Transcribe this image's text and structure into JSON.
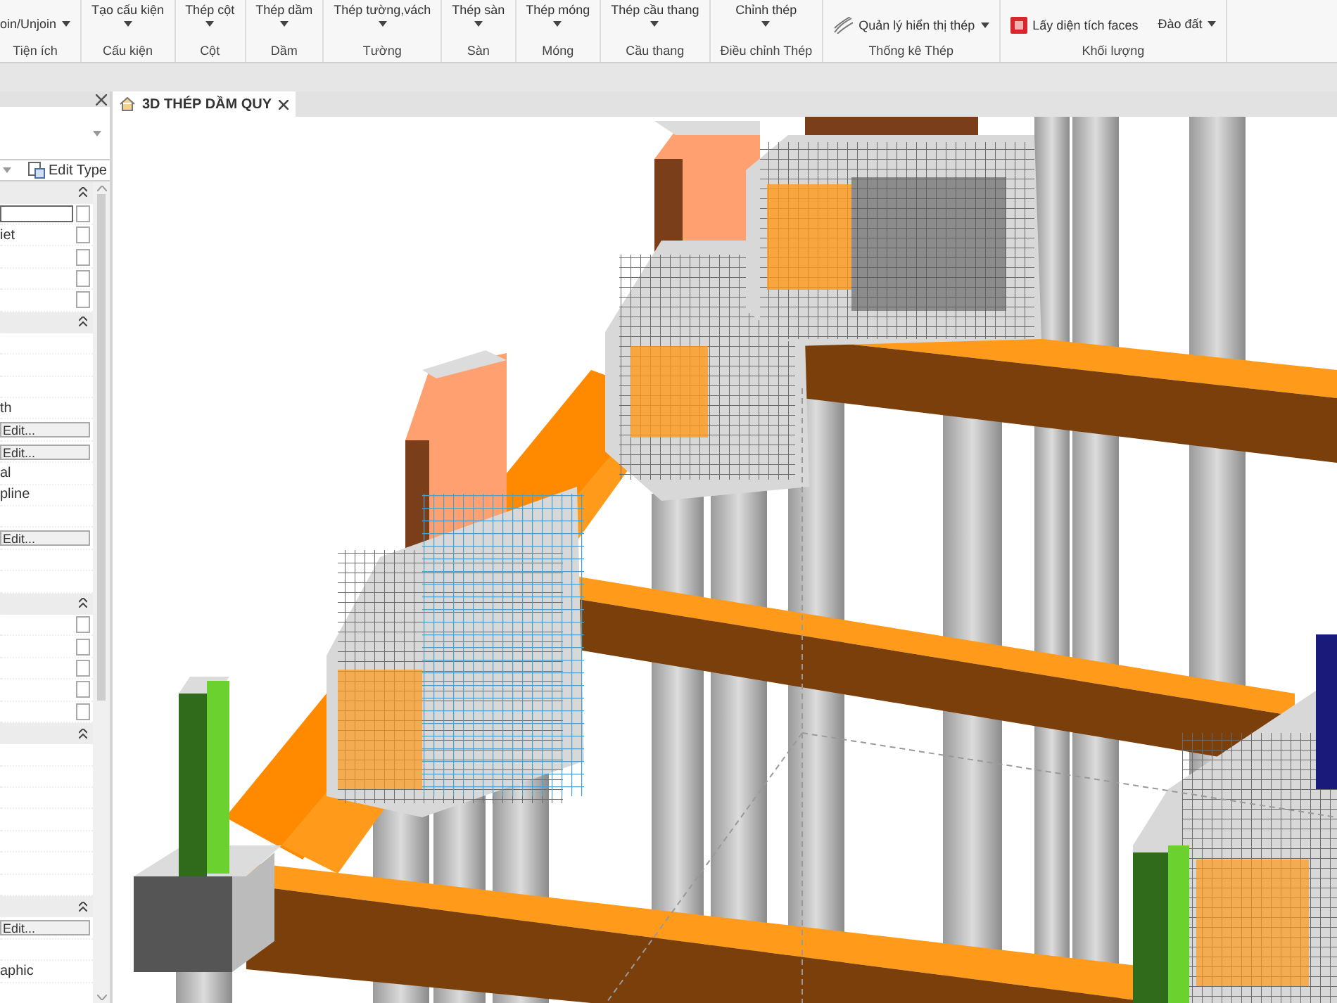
{
  "ribbon": {
    "groups": [
      {
        "label": "Tiện ích",
        "items": [
          {
            "kind": "small",
            "label": "oin/Unjoin",
            "dropdown": true
          }
        ]
      },
      {
        "label": "Cấu kiện",
        "items": [
          {
            "kind": "big",
            "label": "Tạo cấu kiện",
            "dropdown": true
          }
        ]
      },
      {
        "label": "Cột",
        "items": [
          {
            "kind": "big",
            "label": "Thép cột",
            "dropdown": true
          }
        ]
      },
      {
        "label": "Dầm",
        "items": [
          {
            "kind": "big",
            "label": "Thép dầm",
            "dropdown": true
          }
        ]
      },
      {
        "label": "Tường",
        "items": [
          {
            "kind": "big",
            "label": "Thép tường,vách",
            "dropdown": true
          }
        ]
      },
      {
        "label": "Sàn",
        "items": [
          {
            "kind": "big",
            "label": "Thép sàn",
            "dropdown": true
          }
        ]
      },
      {
        "label": "Móng",
        "items": [
          {
            "kind": "big",
            "label": "Thép móng",
            "dropdown": true
          }
        ]
      },
      {
        "label": "Cầu thang",
        "items": [
          {
            "kind": "big",
            "label": "Thép cầu thang",
            "dropdown": true
          }
        ]
      },
      {
        "label": "Điều chỉnh Thép",
        "items": [
          {
            "kind": "big",
            "label": "Chỉnh thép",
            "dropdown": true
          }
        ]
      },
      {
        "label": "Thống kê Thép",
        "items": [
          {
            "kind": "small-wave",
            "label": "Quản lý hiển thị thép",
            "dropdown": true
          }
        ]
      },
      {
        "label": "Khối lượng",
        "items": [
          {
            "kind": "small-red",
            "label": "Lấy diện tích faces",
            "dropdown": false
          },
          {
            "kind": "small",
            "label": "Đào đất",
            "dropdown": true
          }
        ]
      }
    ]
  },
  "properties": {
    "edit_type": "Edit Type",
    "rows": [
      {
        "kind": "header"
      },
      {
        "kind": "field",
        "checked": false
      },
      {
        "kind": "text",
        "label": "iet",
        "checked": false
      },
      {
        "kind": "empty",
        "checked": false
      },
      {
        "kind": "empty",
        "checked": false
      },
      {
        "kind": "empty",
        "checked": false
      },
      {
        "kind": "header"
      },
      {
        "kind": "empty"
      },
      {
        "kind": "empty"
      },
      {
        "kind": "empty"
      },
      {
        "kind": "text",
        "label": "th"
      },
      {
        "kind": "button",
        "label": "Edit..."
      },
      {
        "kind": "button",
        "label": "Edit..."
      },
      {
        "kind": "text",
        "label": "al"
      },
      {
        "kind": "text",
        "label": "pline"
      },
      {
        "kind": "empty"
      },
      {
        "kind": "button",
        "label": "Edit..."
      },
      {
        "kind": "empty"
      },
      {
        "kind": "empty"
      },
      {
        "kind": "header"
      },
      {
        "kind": "empty",
        "checked": false
      },
      {
        "kind": "empty",
        "checked": false
      },
      {
        "kind": "empty",
        "checked": false
      },
      {
        "kind": "empty",
        "checked": false
      },
      {
        "kind": "empty",
        "checked": false
      },
      {
        "kind": "header"
      },
      {
        "kind": "empty"
      },
      {
        "kind": "empty"
      },
      {
        "kind": "empty"
      },
      {
        "kind": "empty"
      },
      {
        "kind": "empty"
      },
      {
        "kind": "empty"
      },
      {
        "kind": "empty"
      },
      {
        "kind": "header"
      },
      {
        "kind": "button",
        "label": "Edit..."
      },
      {
        "kind": "empty"
      },
      {
        "kind": "text",
        "label": "aphic"
      },
      {
        "kind": "empty"
      }
    ]
  },
  "view": {
    "tab": {
      "label": "3D THÉP DẦM QUY",
      "selected": true
    }
  }
}
